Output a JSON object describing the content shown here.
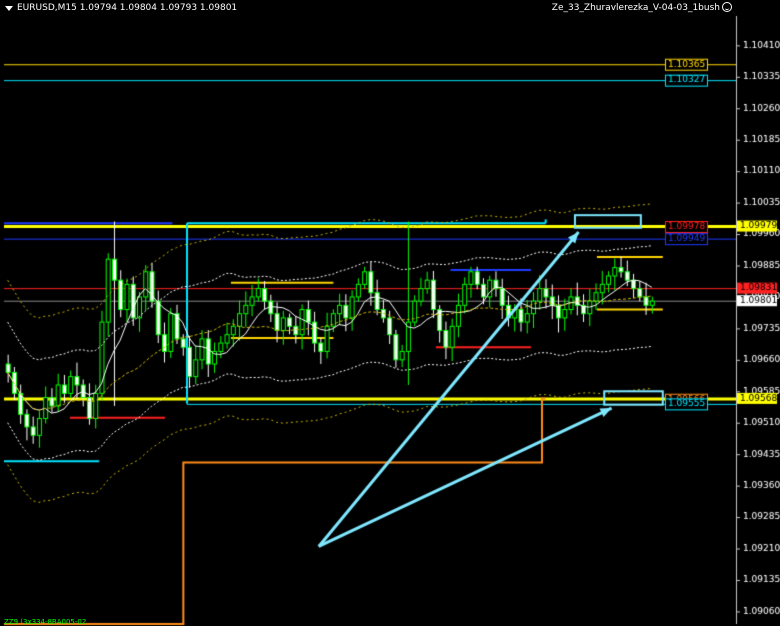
{
  "header": {
    "symbol_info": "EURUSD,M15  1.09794 1.09804 1.09793 1.09801",
    "indicator_name": "Ze_33_Zhuravlerezka_V-04-03_1bush"
  },
  "footer_label": "ZZ9 (3x334-8BA005-02",
  "colors": {
    "background": "#000000",
    "grid": "#c8c8c8",
    "bull_candle": "#00ff00",
    "bear_candle": "#ffffff",
    "yellow_level": "#ffff00",
    "gold_level": "#ffd700",
    "cyan_level": "#00e5ff",
    "blue_level": "#1e3cff",
    "red_level": "#ff2020",
    "orange_step": "#ff8c1a",
    "arrow": "#7fe8ff"
  },
  "chart_data": {
    "type": "candlestick",
    "symbol": "EURUSD",
    "timeframe": "M15",
    "current_price": 1.09801,
    "ylim": [
      1.0903,
      1.1048
    ],
    "y_ticks": [
      1.1041,
      1.10335,
      1.10265,
      1.10195,
      1.10125,
      1.10055,
      1.09985,
      1.09915,
      1.09845,
      1.09775,
      1.09705,
      1.09635,
      1.09565,
      1.09495,
      1.09425,
      1.09355,
      1.09285,
      1.09215,
      1.09145,
      1.09075
    ],
    "y_tick_labels": [
      "1.10410",
      "1.10335",
      "1.10265",
      "1.10195",
      "1.10125",
      "1.10055",
      "1.09985",
      "1.09915",
      "1.09845",
      "1.09775",
      "1.09705",
      "1.09635",
      "1.09565",
      "1.09495",
      "1.09425",
      "1.09355",
      "1.09285",
      "1.09215",
      "1.09145",
      "1.09075"
    ],
    "y_tick_labels_display": [
      "1.10410",
      "1.10335",
      "1.10260",
      "1.10185",
      "1.10110",
      "1.10035",
      "1.09960",
      "1.09885",
      "1.09810",
      "1.09735",
      "1.09660",
      "1.09585",
      "1.09510",
      "1.09435",
      "1.09360",
      "1.09285",
      "1.09210",
      "1.09135",
      "1.09060"
    ],
    "price_labels": [
      {
        "value": 1.10365,
        "text": "1.10365",
        "color": "gold",
        "style": "boxed"
      },
      {
        "value": 1.10327,
        "text": "1.10327",
        "color": "cyan",
        "style": "boxed"
      },
      {
        "value": 1.09978,
        "text": "1.09978",
        "color": "red",
        "style": "boxed"
      },
      {
        "value": 1.09949,
        "text": "1.09949",
        "color": "blue",
        "style": "boxed"
      },
      {
        "value": 1.09566,
        "text": "1.09566",
        "color": "orange",
        "style": "boxed"
      },
      {
        "value": 1.09555,
        "text": "1.09555",
        "color": "cyan",
        "style": "boxed"
      },
      {
        "value": 1.09979,
        "text": "1.09979",
        "color": "yellow",
        "style": "axis"
      },
      {
        "value": 1.09831,
        "text": "1.09831",
        "color": "red",
        "style": "axis"
      },
      {
        "value": 1.09801,
        "text": "1.09801",
        "color": "white",
        "style": "axis"
      },
      {
        "value": 1.09568,
        "text": "1.09568",
        "color": "yellow",
        "style": "axis"
      }
    ],
    "horizontal_levels": [
      {
        "value": 1.10365,
        "color": "gold",
        "from": 0.0,
        "to": 1.0,
        "width": 1
      },
      {
        "value": 1.10327,
        "color": "cyan",
        "from": 0.0,
        "to": 1.0,
        "width": 1
      },
      {
        "value": 1.09979,
        "color": "yellow",
        "from": 0.0,
        "to": 1.0,
        "width": 3
      },
      {
        "value": 1.09949,
        "color": "blue",
        "from": 0.0,
        "to": 1.0,
        "width": 1
      },
      {
        "value": 1.09831,
        "color": "red",
        "from": 0.0,
        "to": 1.0,
        "width": 1
      },
      {
        "value": 1.09801,
        "color": "grey",
        "from": 0.0,
        "to": 1.0,
        "width": 1
      },
      {
        "value": 1.09568,
        "color": "yellow",
        "from": 0.0,
        "to": 1.0,
        "width": 3
      },
      {
        "value": 1.09555,
        "color": "cyan",
        "from": 0.25,
        "to": 1.0,
        "width": 1
      }
    ],
    "segments": [
      {
        "y": 1.09986,
        "x0": 0.0,
        "x1": 0.23,
        "color": "blue"
      },
      {
        "y": 1.09986,
        "x0": 0.25,
        "x1": 0.74,
        "color": "cyan"
      },
      {
        "y": 1.09844,
        "x0": 0.31,
        "x1": 0.45,
        "color": "gold"
      },
      {
        "y": 1.09712,
        "x0": 0.31,
        "x1": 0.45,
        "color": "gold"
      },
      {
        "y": 1.09874,
        "x0": 0.61,
        "x1": 0.72,
        "color": "blue"
      },
      {
        "y": 1.0969,
        "x0": 0.59,
        "x1": 0.72,
        "color": "red"
      },
      {
        "y": 1.09522,
        "x0": 0.09,
        "x1": 0.22,
        "color": "red"
      },
      {
        "y": 1.09418,
        "x0": 0.0,
        "x1": 0.13,
        "color": "cyan"
      },
      {
        "y": 1.09905,
        "x0": 0.81,
        "x1": 0.9,
        "color": "gold"
      },
      {
        "y": 1.0978,
        "x0": 0.81,
        "x1": 0.9,
        "color": "gold"
      }
    ],
    "vertical_markers": [
      {
        "x": 0.25,
        "y0": 1.09986,
        "y1": 1.09555,
        "color": "cyan"
      },
      {
        "x": 0.74,
        "y0": 1.09995,
        "y1": 1.09986,
        "color": "cyan"
      }
    ],
    "orange_step": [
      [
        0.0,
        1.0903
      ],
      [
        0.245,
        1.0903
      ],
      [
        0.245,
        1.09415
      ],
      [
        0.735,
        1.09415
      ],
      [
        0.735,
        1.09568
      ],
      [
        0.74,
        1.09568
      ]
    ],
    "highlight_boxes": [
      {
        "x0": 0.78,
        "x1": 0.87,
        "y0": 1.10005,
        "y1": 1.09975
      },
      {
        "x0": 0.82,
        "x1": 0.9,
        "y0": 1.09585,
        "y1": 1.09553
      }
    ],
    "arrows": [
      {
        "from": [
          0.43,
          1.09215
        ],
        "to": [
          0.785,
          1.09965
        ]
      },
      {
        "from": [
          0.43,
          1.09215
        ],
        "to": [
          0.83,
          1.09545
        ]
      }
    ],
    "close_series": [
      1.0963,
      1.0958,
      1.0953,
      1.095,
      1.0948,
      1.0952,
      1.0957,
      1.0955,
      1.096,
      1.0958,
      1.0962,
      1.096,
      1.0957,
      1.0952,
      1.0958,
      1.0975,
      1.099,
      1.0985,
      1.0978,
      1.0984,
      1.0976,
      1.0981,
      1.0987,
      1.098,
      1.0972,
      1.0968,
      1.0977,
      1.0971,
      1.0969,
      1.0962,
      1.0966,
      1.0971,
      1.0965,
      1.0968,
      1.097,
      1.0972,
      1.0974,
      1.0977,
      1.0979,
      1.0981,
      1.0983,
      1.098,
      1.0977,
      1.0973,
      1.0976,
      1.0974,
      1.0972,
      1.0978,
      1.0975,
      1.097,
      1.0968,
      1.0974,
      1.0977,
      1.0979,
      1.0976,
      1.0981,
      1.0984,
      1.0987,
      1.0982,
      1.0978,
      1.0976,
      1.0972,
      1.0966,
      1.0968,
      1.0975,
      1.098,
      1.0983,
      1.0985,
      1.0978,
      1.0973,
      1.0969,
      1.0974,
      1.0979,
      1.0984,
      1.0987,
      1.0984,
      1.0981,
      1.0985,
      1.0983,
      1.0979,
      1.0976,
      1.0978,
      1.0975,
      1.0977,
      1.098,
      1.0983,
      1.0981,
      1.0979,
      1.0976,
      1.0978,
      1.0981,
      1.0979,
      1.0977,
      1.098,
      1.0982,
      1.0984,
      1.0986,
      1.0988,
      1.0987,
      1.0985,
      1.0983,
      1.0981,
      1.0979,
      1.098
    ],
    "high_low_spikes": [
      {
        "i": 17,
        "high": 1.0999,
        "low": 1.0955
      },
      {
        "i": 64,
        "high": 1.0999,
        "low": 1.096
      }
    ]
  }
}
